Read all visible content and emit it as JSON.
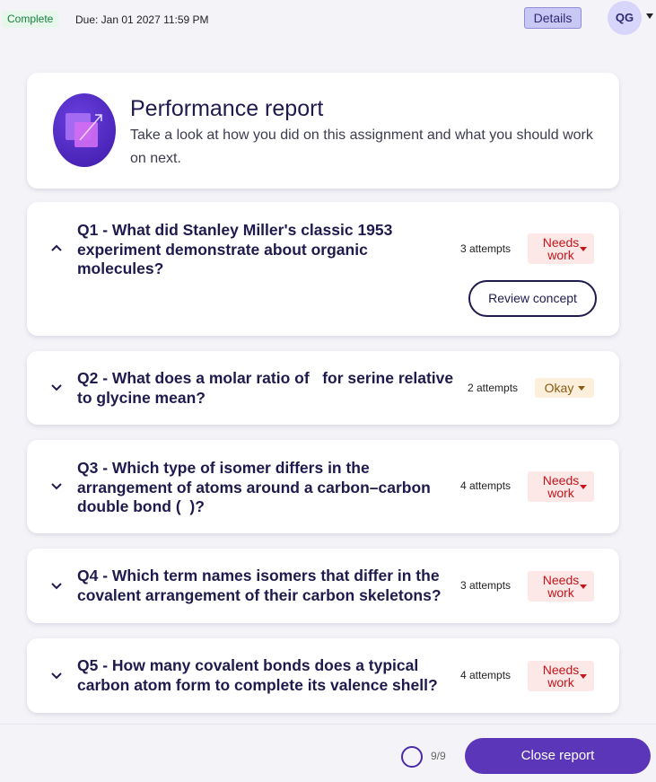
{
  "header": {
    "status": "Complete",
    "due": "Due: Jan 01 2027 11:59 PM",
    "details_label": "Details",
    "avatar_initials": "QG"
  },
  "report": {
    "title": "Performance report",
    "subtitle": "Take a look at how you did on this assignment and what you should work on next."
  },
  "questions": [
    {
      "title": "Q1 - What did Stanley Miller's classic 1953 experiment demonstrate about organic molecules?",
      "attempts": "3 attempts",
      "rating_line1": "Needs",
      "rating_line2": "work",
      "expanded": true,
      "action_label": "Review concept"
    },
    {
      "title": "Q2 - What does a molar ratio of   for serine relative to glycine mean?",
      "attempts": "2 attempts",
      "rating": "Okay",
      "expanded": false
    },
    {
      "title": "Q3 - Which type of isomer differs in the arrangement of atoms around a carbon–carbon double bond (  )?",
      "attempts": "4 attempts",
      "rating_line1": "Needs",
      "rating_line2": "work",
      "expanded": false
    },
    {
      "title": "Q4 - Which term names isomers that differ in the covalent arrangement of their carbon skeletons?",
      "attempts": "3 attempts",
      "rating_line1": "Needs",
      "rating_line2": "work",
      "expanded": false
    },
    {
      "title": "Q5 - How many covalent bonds does a typical carbon atom form to complete its valence shell?",
      "attempts": "4 attempts",
      "rating_line1": "Needs",
      "rating_line2": "work",
      "expanded": false
    }
  ],
  "footer": {
    "progress": "9/9",
    "close_label": "Close report"
  },
  "colors": {
    "accent": "#5b36b8",
    "needs_work": "#c4161c",
    "okay": "#8a5a10",
    "complete": "#16803c"
  }
}
